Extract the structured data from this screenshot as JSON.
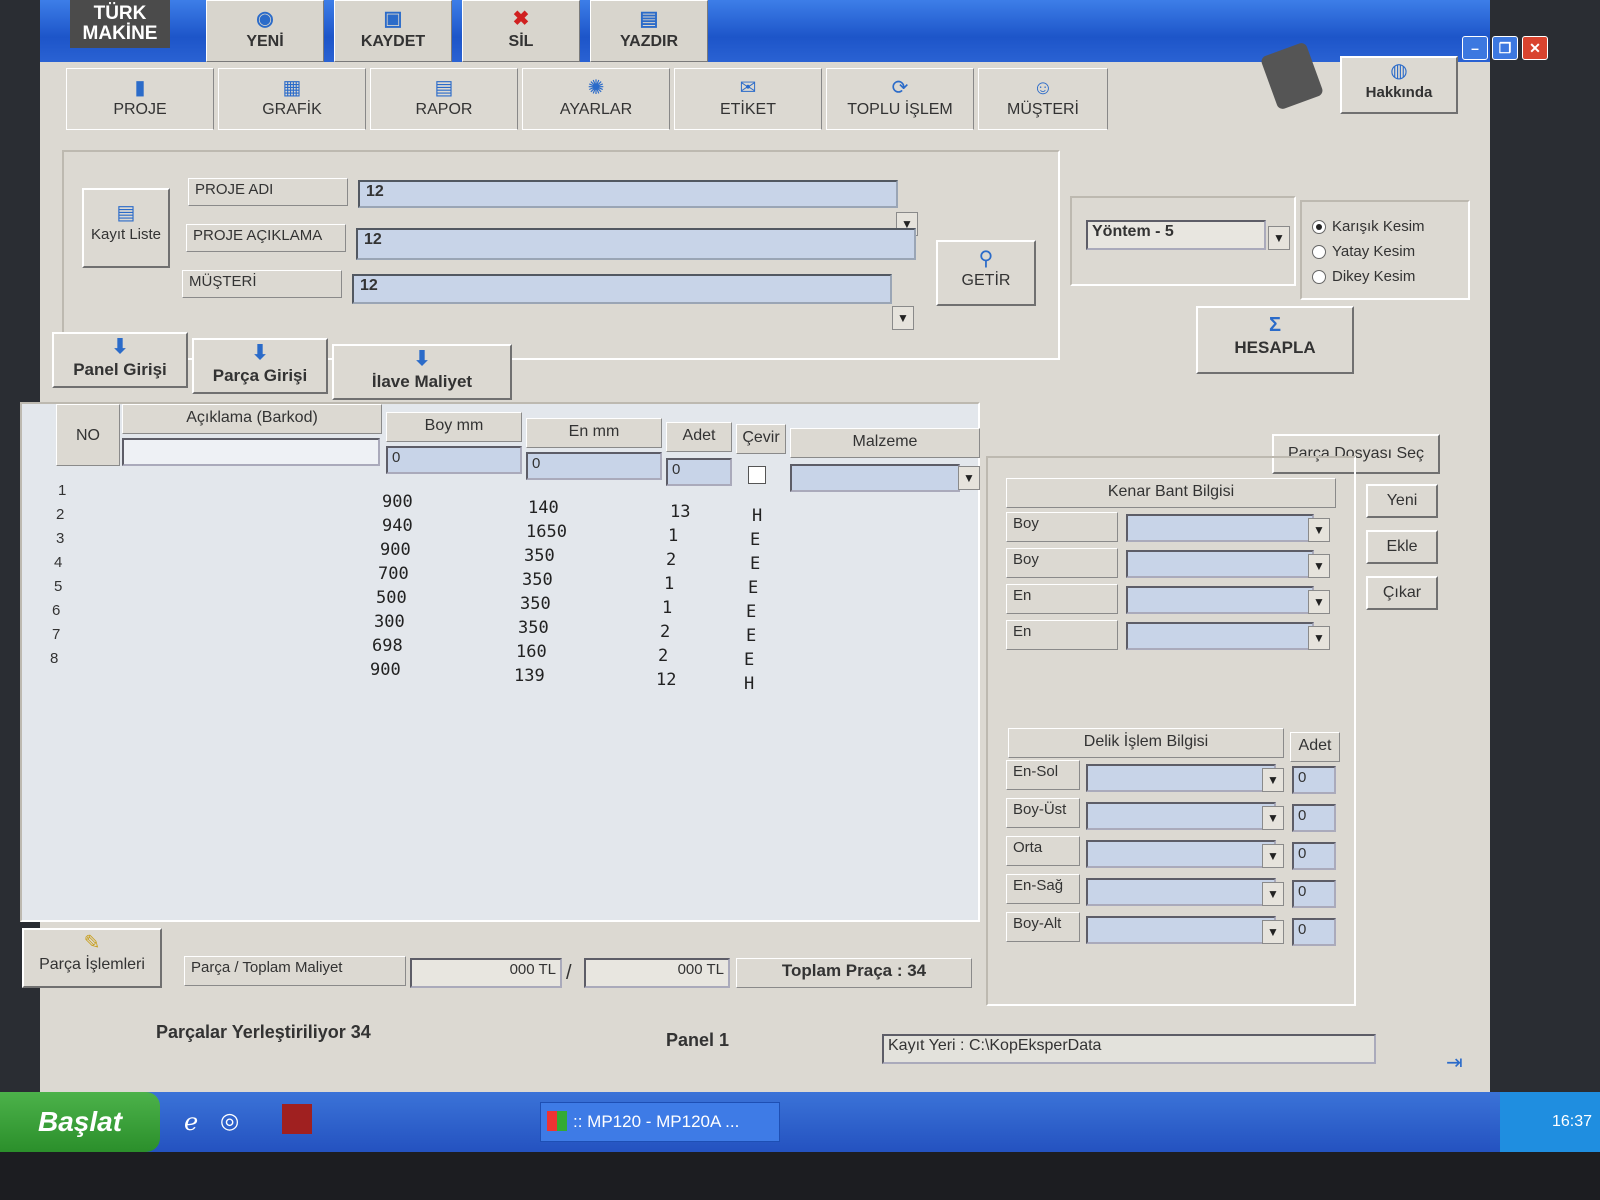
{
  "logo": {
    "line1": "TÜRK",
    "line2": "MAKİNE"
  },
  "toolbar": [
    {
      "label": "YENİ",
      "icon": "new-icon"
    },
    {
      "label": "KAYDET",
      "icon": "save-icon"
    },
    {
      "label": "SİL",
      "icon": "delete-icon"
    },
    {
      "label": "YAZDIR",
      "icon": "print-icon"
    }
  ],
  "hakkinda": "Hakkında",
  "tabs": [
    "PROJE",
    "GRAFİK",
    "RAPOR",
    "AYARLAR",
    "ETİKET",
    "TOPLU İŞLEM",
    "MÜŞTERİ"
  ],
  "kayit_liste": "Kayıt Liste",
  "form": {
    "proje_adi_label": "PROJE ADI",
    "proje_adi_value": "12",
    "proje_aciklama_label": "PROJE AÇIKLAMA",
    "proje_aciklama_value": "12",
    "musteri_label": "MÜŞTERİ",
    "musteri_value": "12"
  },
  "getir": "GETİR",
  "yontem": "Yöntem - 5",
  "cut_options": [
    {
      "label": "Karışık Kesim",
      "selected": true
    },
    {
      "label": "Yatay Kesim",
      "selected": false
    },
    {
      "label": "Dikey Kesim",
      "selected": false
    }
  ],
  "hesapla": "HESAPLA",
  "entry_buttons": [
    "Panel Girişi",
    "Parça Girişi",
    "İlave Maliyet"
  ],
  "columns": {
    "no": "NO",
    "aciklama": "Açıklama (Barkod)",
    "boy": "Boy mm",
    "en": "En mm",
    "adet": "Adet",
    "cevir": "Çevir",
    "malzeme": "Malzeme"
  },
  "inputs": {
    "boy": "0",
    "en": "0",
    "adet": "0"
  },
  "rows": [
    {
      "no": "1",
      "boy": "900",
      "en": "140",
      "adet": "13",
      "cevir": "H"
    },
    {
      "no": "2",
      "boy": "940",
      "en": "1650",
      "adet": "1",
      "cevir": "E"
    },
    {
      "no": "3",
      "boy": "900",
      "en": "350",
      "adet": "2",
      "cevir": "E"
    },
    {
      "no": "4",
      "boy": "700",
      "en": "350",
      "adet": "1",
      "cevir": "E"
    },
    {
      "no": "5",
      "boy": "500",
      "en": "350",
      "adet": "1",
      "cevir": "E"
    },
    {
      "no": "6",
      "boy": "300",
      "en": "350",
      "adet": "2",
      "cevir": "E"
    },
    {
      "no": "7",
      "boy": "698",
      "en": "160",
      "adet": "2",
      "cevir": "E"
    },
    {
      "no": "8",
      "boy": "900",
      "en": "139",
      "adet": "12",
      "cevir": "H"
    }
  ],
  "parca_dosyasi_sec": "Parça Dosyası Seç",
  "kenar_bant": {
    "title": "Kenar Bant Bilgisi",
    "labels": [
      "Boy",
      "Boy",
      "En",
      "En"
    ]
  },
  "side_buttons": [
    "Yeni",
    "Ekle",
    "Çıkar"
  ],
  "delik": {
    "title": "Delik İşlem Bilgisi",
    "adet_label": "Adet",
    "rows": [
      {
        "label": "En-Sol",
        "value": "0"
      },
      {
        "label": "Boy-Üst",
        "value": "0"
      },
      {
        "label": "Orta",
        "value": "0"
      },
      {
        "label": "En-Sağ",
        "value": "0"
      },
      {
        "label": "Boy-Alt",
        "value": "0"
      }
    ]
  },
  "parca_islemleri": "Parça İşlemleri",
  "maliyet": {
    "label": "Parça / Toplam Maliyet",
    "parca": "000 TL",
    "sep": "/",
    "toplam": "000 TL",
    "toplam_parca": "Toplam Praça : 34"
  },
  "status": {
    "left": "Parçalar Yerleştiriliyor 34",
    "center": "Panel 1",
    "kayit_yeri": "Kayıt Yeri : C:\\KopEksperData"
  },
  "taskbar": {
    "start": "Başlat",
    "item": ":: MP120 - MP120A ...",
    "time": "16:37"
  }
}
